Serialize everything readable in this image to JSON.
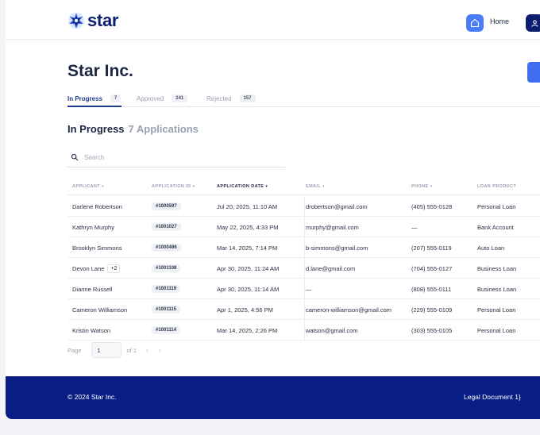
{
  "brand": {
    "name": "star"
  },
  "nav": {
    "home_label": "Home",
    "home_icon": "home-icon",
    "user_icon": "user-icon"
  },
  "page": {
    "title": "Star Inc."
  },
  "tabs": [
    {
      "label": "In Progress",
      "count": "7"
    },
    {
      "label": "Approved",
      "count": "241"
    },
    {
      "label": "Rejected",
      "count": "157"
    }
  ],
  "section": {
    "title": "In Progress",
    "subtitle": "7 Applications"
  },
  "search": {
    "placeholder": "Search"
  },
  "table": {
    "columns": [
      "APPLICANT",
      "APPLICATION ID",
      "APPLICATION DATE",
      "EMAIL",
      "PHONE",
      "LOAN PRODUCT"
    ],
    "rows": [
      {
        "applicant": "Darlene Robertson",
        "extra": "",
        "id": "#1000597",
        "date": "Jul 20, 2025, 11:10 AM",
        "email": "drobertson@gmail.com",
        "phone": "(405) 555-0128",
        "product": "Personal Loan"
      },
      {
        "applicant": "Kathryn Murphy",
        "extra": "",
        "id": "#1001027",
        "date": "May 22, 2025, 4:33 PM",
        "email": "murphy@gmail.com",
        "phone": "—",
        "product": "Bank Account"
      },
      {
        "applicant": "Brooklyn Simmons",
        "extra": "",
        "id": "#1000486",
        "date": "Mar 14, 2025, 7:14 PM",
        "email": "b-simmons@gmail.com",
        "phone": "(207) 555-0119",
        "product": "Auto Loan"
      },
      {
        "applicant": "Devon Lane",
        "extra": "+2",
        "id": "#1001108",
        "date": "Apr 30, 2025, 11:24 AM",
        "email": "d.lane@gmail.com",
        "phone": "(704) 555-0127",
        "product": "Business Loan"
      },
      {
        "applicant": "Dianne Russell",
        "extra": "",
        "id": "#1001119",
        "date": "Apr 30, 2025, 11:14 AM",
        "email": "—",
        "phone": "(808) 555-0111",
        "product": "Business Loan"
      },
      {
        "applicant": "Cameron Williamson",
        "extra": "",
        "id": "#1001115",
        "date": "Apr 1, 2025, 4:56 PM",
        "email": "cameron-williamson@gmail.com",
        "phone": "(229) 555-0109",
        "product": "Personal Loan"
      },
      {
        "applicant": "Kristin Watson",
        "extra": "",
        "id": "#1001114",
        "date": "Mar 14, 2025, 2:26 PM",
        "email": "watson@gmail.com",
        "phone": "(303) 555-0105",
        "product": "Personal Loan"
      }
    ]
  },
  "pagination": {
    "label": "Page",
    "value": "1",
    "of_label": "of 1"
  },
  "footer": {
    "copyright": "© 2024 Star Inc.",
    "legal": "Legal Document 1}"
  },
  "colors": {
    "primary": "#0c1f6e",
    "accent": "#4a7cf4",
    "footer": "#081e84"
  }
}
